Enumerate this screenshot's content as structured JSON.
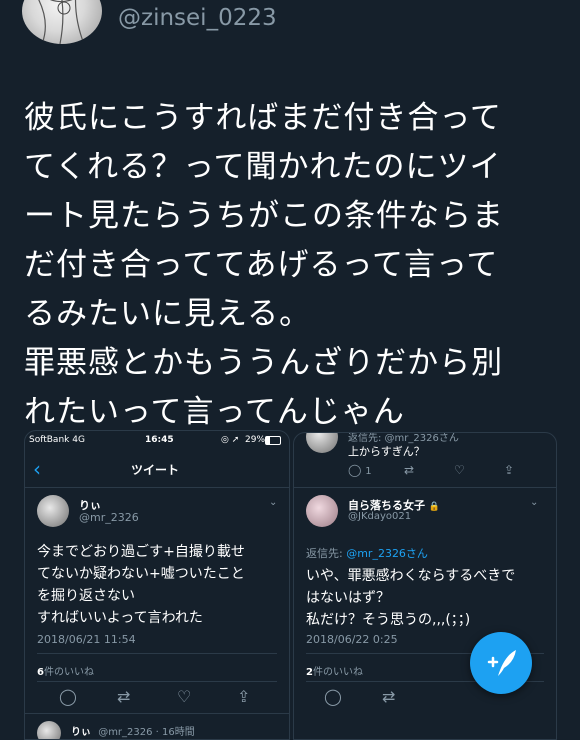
{
  "header": {
    "handle": "@zinsei_0223"
  },
  "tweet": {
    "lines": [
      "彼氏にこうすればまだ付き合って",
      "てくれる？って聞かれたのにツイ",
      "ート見たらうちがこの条件ならま",
      "だ付き合っててあげるって言って",
      "るみたいに見える。",
      "罪悪感とかもううんざりだから別",
      "れたいって言ってんじゃん"
    ]
  },
  "left_shot": {
    "carrier": "SoftBank 4G",
    "time": "16:45",
    "battery": "29%",
    "nav_title": "ツイート",
    "author_name": "りぃ",
    "author_handle": "@mr_2326",
    "body": [
      "今までどおり過ごす+自撮り載せ",
      "てないか疑わない+嘘ついたこと",
      "を掘り返さない",
      "すればいいよって言われた"
    ],
    "timestamp": "2018/06/21 11:54",
    "likes_count": "6",
    "likes_label": "件のいいね",
    "reply_author": "りぃ",
    "reply_meta": "@mr_2326 · 16時間"
  },
  "right_shot": {
    "top_reply_to": "返信先: @mr_2326さん",
    "top_text": "上からすぎん？",
    "top_reply_count": "1",
    "author_name": "自ら落ちる女子",
    "author_handle": "@JKdayo021",
    "reply_to_prefix": "返信先: ",
    "reply_to_handle": "@mr_2326さん",
    "body": [
      "いや、罪悪感わくならするべきで",
      "はないはず？",
      "私だけ？そう思うの,,,(；；)"
    ],
    "timestamp": "2018/06/22 0:25",
    "likes_count": "2",
    "likes_label": "件のいいね"
  },
  "colors": {
    "background": "#15202b",
    "accent": "#1da1f2",
    "muted": "#8899a6"
  },
  "icons": [
    "back-chevron-icon",
    "reply-icon",
    "retweet-icon",
    "like-icon",
    "share-icon",
    "compose-tweet-icon",
    "lock-icon"
  ]
}
